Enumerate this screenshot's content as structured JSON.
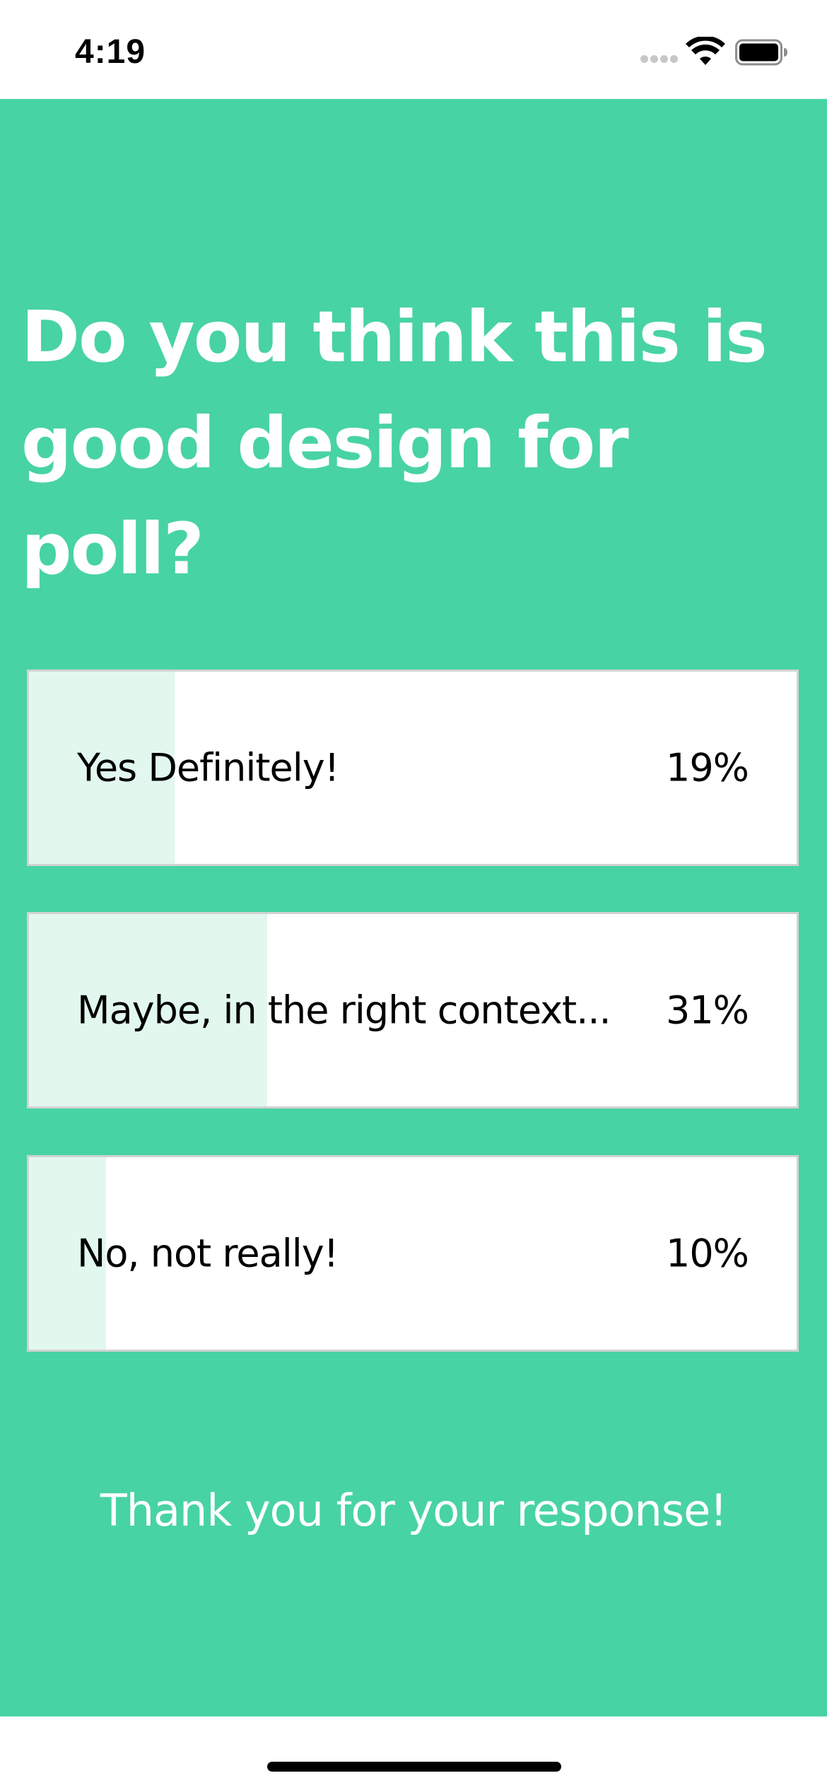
{
  "status_bar": {
    "time": "4:19"
  },
  "poll": {
    "question": "Do you think this is good design for poll?",
    "options": [
      {
        "label": "Yes Definitely!",
        "percent_text": "19%",
        "fill_fraction": 0.19
      },
      {
        "label": "Maybe, in the right context...",
        "percent_text": "31%",
        "fill_fraction": 0.31
      },
      {
        "label": "No, not really!",
        "percent_text": "10%",
        "fill_fraction": 0.1
      }
    ],
    "thank_you": "Thank you for your response!"
  },
  "colors": {
    "accent": "#48d3a4",
    "bar_fill": "#e2f8ee",
    "text_on_accent": "#ffffff",
    "option_text": "#000000"
  },
  "icons": {
    "signal": "cellular-signal-icon",
    "wifi": "wifi-icon",
    "battery": "battery-icon"
  }
}
